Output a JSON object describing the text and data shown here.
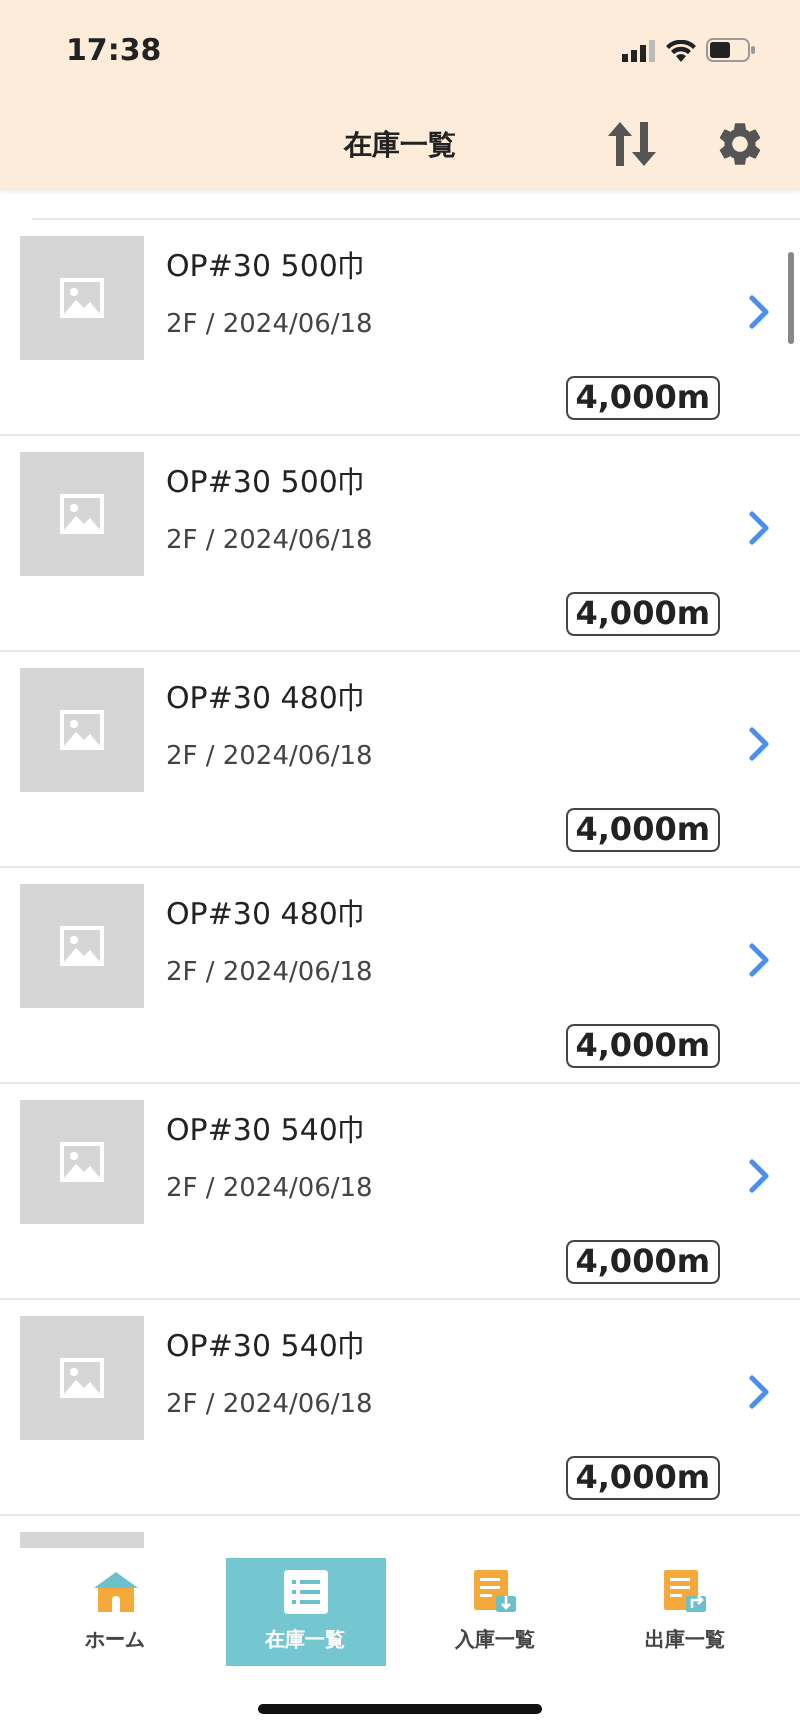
{
  "status_bar": {
    "time": "17:38"
  },
  "header": {
    "title": "在庫一覧"
  },
  "items": [
    {
      "title": "OP#30 500巾",
      "subtitle": "2F / 2024/06/18",
      "quantity": "4,000m"
    },
    {
      "title": "OP#30 500巾",
      "subtitle": "2F / 2024/06/18",
      "quantity": "4,000m"
    },
    {
      "title": "OP#30 480巾",
      "subtitle": "2F / 2024/06/18",
      "quantity": "4,000m"
    },
    {
      "title": "OP#30 480巾",
      "subtitle": "2F / 2024/06/18",
      "quantity": "4,000m"
    },
    {
      "title": "OP#30 540巾",
      "subtitle": "2F / 2024/06/18",
      "quantity": "4,000m"
    },
    {
      "title": "OP#30 540巾",
      "subtitle": "2F / 2024/06/18",
      "quantity": "4,000m"
    }
  ],
  "tabs": [
    {
      "label": "ホーム",
      "kind": "home",
      "selected": false
    },
    {
      "label": "在庫一覧",
      "kind": "list",
      "selected": true
    },
    {
      "label": "入庫一覧",
      "kind": "inbound",
      "selected": false
    },
    {
      "label": "出庫一覧",
      "kind": "outbound",
      "selected": false
    }
  ]
}
